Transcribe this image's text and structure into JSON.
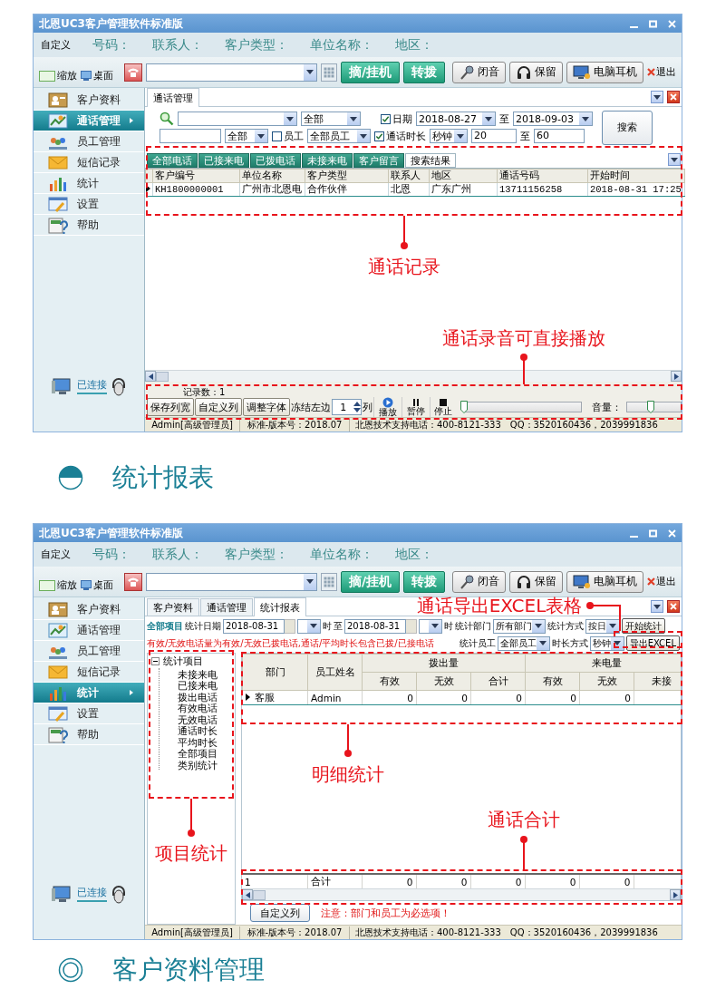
{
  "blocks": [
    {
      "kind": "window",
      "title": "北恩UC3客户管理软件标准版",
      "info_bar": {
        "button": "自定义",
        "labels": [
          "号码：",
          "联系人：",
          "客户类型：",
          "单位名称：",
          "地区："
        ]
      },
      "toolbar": {
        "zoom": "缩放",
        "desktop": "桌面",
        "pickup": "摘/挂机",
        "transfer": "转拨",
        "mute": "闭音",
        "hold": "保留",
        "headset": "电脑耳机",
        "exit": "退出"
      },
      "sidebar": [
        {
          "label": "客户资料",
          "selected": false
        },
        {
          "label": "通话管理",
          "selected": true
        },
        {
          "label": "员工管理",
          "selected": false
        },
        {
          "label": "短信记录",
          "selected": false
        },
        {
          "label": "统计",
          "selected": false
        },
        {
          "label": "设置",
          "selected": false
        },
        {
          "label": "帮助",
          "selected": false
        }
      ],
      "connection": "已连接",
      "content": {
        "kind": "call_log",
        "tabs": [
          {
            "label": "通话管理",
            "selected": true
          }
        ],
        "search": {
          "scope": "全部",
          "date": {
            "label": "日期",
            "checked": true,
            "from": "2018-08-27",
            "to_word": "至",
            "to": "2018-09-03"
          },
          "button": "搜索",
          "type_filter": "全部",
          "employee": {
            "label": "员工",
            "checked": false,
            "value": "全部员工"
          },
          "duration": {
            "label": "通话时长",
            "checked": true,
            "unit": "秒钟",
            "from": "20",
            "to_word": "至",
            "to": "60"
          }
        },
        "subtabs": [
          {
            "label": "全部电话",
            "selected": false
          },
          {
            "label": "已接来电",
            "selected": false
          },
          {
            "label": "已拨电话",
            "selected": false
          },
          {
            "label": "未接来电",
            "selected": false
          },
          {
            "label": "客户留言",
            "selected": false
          },
          {
            "label": "搜索结果",
            "selected": true
          }
        ],
        "columns": [
          "客户编号",
          "单位名称",
          "客户类型",
          "联系人",
          "地区",
          "通话号码",
          "开始时间"
        ],
        "rows": [
          [
            "KH1800000001",
            "广州市北恩电",
            "合作伙伴",
            "北恩",
            "广东广州",
            "13711156258",
            "2018-08-31 17:25"
          ]
        ],
        "record_count": "记录数：1",
        "actions": [
          "保存列宽",
          "自定义列",
          "调整字体"
        ],
        "freeze": {
          "label": "冻结左边",
          "value": "1",
          "unit": "列"
        },
        "player": [
          {
            "kind": "play",
            "label": "播放"
          },
          {
            "kind": "pause",
            "label": "暂停"
          },
          {
            "kind": "stop",
            "label": "停止"
          }
        ],
        "seek": {
          "level": 0
        },
        "volume": {
          "label": "音量：",
          "level": 0.45
        }
      },
      "status_bar": [
        "Admin[高级管理员]",
        "标准-版本号：2018.07",
        "北恩技术支持电话：400-8121-333",
        "QQ：3520160436，2039991836"
      ],
      "annotations": [
        {
          "text": "通话记录"
        },
        {
          "text": "通话录音可直接播放"
        }
      ]
    },
    {
      "kind": "heading",
      "marker_filled": true,
      "text": "统计报表"
    },
    {
      "kind": "window",
      "title": "北恩UC3客户管理软件标准版",
      "info_bar": {
        "button": "自定义",
        "labels": [
          "号码：",
          "联系人：",
          "客户类型：",
          "单位名称：",
          "地区："
        ]
      },
      "toolbar": {
        "zoom": "缩放",
        "desktop": "桌面",
        "pickup": "摘/挂机",
        "transfer": "转拨",
        "mute": "闭音",
        "hold": "保留",
        "headset": "电脑耳机",
        "exit": "退出"
      },
      "sidebar": [
        {
          "label": "客户资料",
          "selected": false
        },
        {
          "label": "通话管理",
          "selected": false
        },
        {
          "label": "员工管理",
          "selected": false
        },
        {
          "label": "短信记录",
          "selected": false
        },
        {
          "label": "统计",
          "selected": true
        },
        {
          "label": "设置",
          "selected": false
        },
        {
          "label": "帮助",
          "selected": false
        }
      ],
      "connection": "已连接",
      "content": {
        "kind": "stats_report",
        "tabs": [
          {
            "label": "客户资料",
            "selected": false
          },
          {
            "label": "通话管理",
            "selected": false
          },
          {
            "label": "统计报表",
            "selected": true
          }
        ],
        "filter_rows": [
          [
            {
              "kind": "scope",
              "text": "全部项目"
            },
            {
              "kind": "label",
              "text": "统计日期"
            },
            {
              "kind": "date",
              "value": "2018-08-31"
            },
            {
              "kind": "combo"
            },
            {
              "kind": "label",
              "text": "时"
            },
            {
              "kind": "label",
              "text": "至"
            },
            {
              "kind": "date",
              "value": "2018-08-31"
            },
            {
              "kind": "combo"
            },
            {
              "kind": "label",
              "text": "时"
            },
            {
              "kind": "label",
              "text": "统计部门"
            },
            {
              "kind": "combo",
              "value": "所有部门"
            },
            {
              "kind": "label",
              "text": "统计方式"
            },
            {
              "kind": "combo",
              "value": "按日"
            },
            {
              "kind": "button",
              "text": "开始统计"
            }
          ],
          [
            {
              "kind": "note",
              "text": "有效/无效电话量为有效/无效已拨电话,通话/平均时长包含已拨/已接电话"
            },
            {
              "kind": "label",
              "text": "统计员工"
            },
            {
              "kind": "combo",
              "value": "全部员工"
            },
            {
              "kind": "label",
              "text": "时长方式"
            },
            {
              "kind": "combo",
              "value": "秒钟"
            },
            {
              "kind": "button",
              "text": "导出EXCEL"
            }
          ]
        ],
        "tree": {
          "label": "统计项目",
          "expanded": true,
          "children": [
            {
              "label": "未接来电"
            },
            {
              "label": "已接来电"
            },
            {
              "label": "拨出电话"
            },
            {
              "label": "有效电话"
            },
            {
              "label": "无效电话"
            },
            {
              "label": "通话时长"
            },
            {
              "label": "平均时长"
            },
            {
              "label": "全部项目"
            },
            {
              "label": "类别统计"
            }
          ]
        },
        "header_rows": [
          [
            {
              "text": "部门",
              "rowspan": 2
            },
            {
              "text": "员工姓名",
              "rowspan": 2
            },
            {
              "text": "拨出量",
              "colspan": 3
            },
            {
              "text": "来电量",
              "colspan": 3
            }
          ],
          [
            {
              "text": "有效"
            },
            {
              "text": "无效"
            },
            {
              "text": "合计"
            },
            {
              "text": "有效"
            },
            {
              "text": "无效"
            },
            {
              "text": "未接"
            }
          ]
        ],
        "rows": [
          [
            "客服",
            "Admin",
            "0",
            "0",
            "0",
            "0",
            "0"
          ]
        ],
        "totals": [
          "1",
          "合计",
          "0",
          "0",
          "0",
          "0",
          "0"
        ],
        "footer_button": "自定义列",
        "footer_note": "注意：部门和员工为必选项！"
      },
      "status_bar": [
        "Admin[高级管理员]",
        "标准-版本号：2018.07",
        "北恩技术支持电话：400-8121-333",
        "QQ：3520160436，2039991836"
      ],
      "annotations": [
        {
          "text": "通话导出EXCEL表格"
        },
        {
          "text": "项目统计"
        },
        {
          "text": "明细统计"
        },
        {
          "text": "通话合计"
        }
      ]
    },
    {
      "kind": "heading",
      "marker_filled": false,
      "text": "客户资料管理"
    }
  ]
}
